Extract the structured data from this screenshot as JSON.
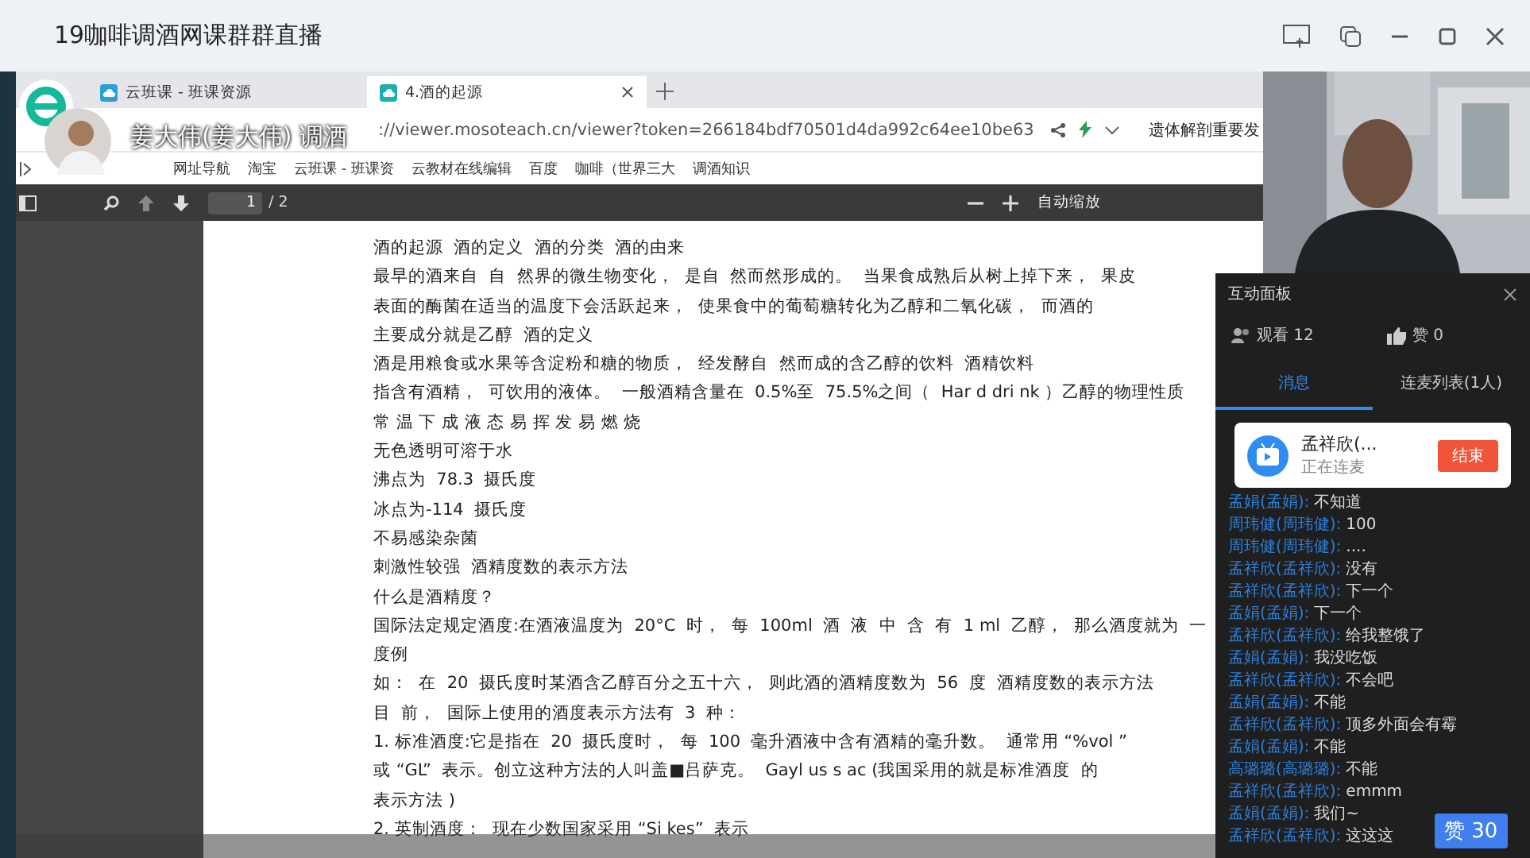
{
  "window": {
    "title": "19咖啡调酒网课群群直播"
  },
  "browser": {
    "tabs": [
      {
        "label": "云班课 - 班课资源",
        "selected": false
      },
      {
        "label": "4.酒的起源",
        "selected": true
      }
    ],
    "url": "://viewer.mosoteach.cn/viewer?token=266184bdf70501d4da992c64ee10be63",
    "presenter": "姜大伟(姜大伟) 调酒",
    "news": "遗体解剖重要发",
    "bookmarks": [
      "网址导航",
      "淘宝",
      "云班课 - 班课资",
      "云教材在线编辑",
      "百度",
      "咖啡（世界三大",
      "调酒知识"
    ]
  },
  "pdf": {
    "page": "1",
    "total": "/ 2",
    "zoom": "自动缩放",
    "lines": [
      "酒的起源  酒的定义  酒的分类  酒的由来",
      "最早的酒来自  自  然界的微生物变化，  是自  然而然形成的。  当果食成熟后从树上掉下来，  果皮",
      "表面的酶菌在适当的温度下会活跃起来，  使果食中的葡萄糖转化为乙醇和二氧化碳，  而酒的",
      "主要成分就是乙醇  酒的定义",
      "酒是用粮食或水果等含淀粉和糖的物质，  经发酵自  然而成的含乙醇的饮料  酒精饮料",
      "指含有酒精，  可饮用的液体。  一般酒精含量在  0.5%至  75.5%之间（  Har d dri nk ）乙醇的物理性质",
      "常 温 下 成 液 态 易 挥 发 易 燃 烧",
      "无色透明可溶于水",
      "沸点为  78.3  摄氏度",
      "冰点为-114  摄氏度",
      "不易感染杂菌",
      "刺激性较强  酒精度数的表示方法",
      "什么是酒精度？",
      "国际法定规定酒度:在酒液温度为  20°C  时，  每  100ml  酒  液  中  含  有  1 ml  乙醇，  那么酒度就为  一",
      "度例",
      "如：  在  20  摄氏度时某酒含乙醇百分之五十六，  则此酒的酒精度数为  56  度  酒精度数的表示方法",
      "目  前，  国际上使用的酒度表示方法有  3  种：",
      "1. 标准酒度:它是指在  20  摄氏度时，  每  100  毫升酒液中含有酒精的毫升数。  通常用 “%vol ”",
      "或 “GL”  表示。创立这种方法的人叫盖■吕萨克。  Gayl us s ac (我国采用的就是标准酒度  的",
      "表示方法 )",
      "2. 英制酒度：  现在少数国家采用 “Si kes”  表示"
    ]
  },
  "panel": {
    "title": "互动面板",
    "viewers": "观看 12",
    "likes": "赞 0",
    "tabs": [
      {
        "label": "消息",
        "selected": true
      },
      {
        "label": "连麦列表(1人)",
        "selected": false
      }
    ],
    "call": {
      "name": "孟祥欣(...",
      "status": "正在连麦",
      "button": "结束"
    },
    "messages": [
      {
        "name": "孟娟(孟娟):",
        "text": "不知道"
      },
      {
        "name": "周玮健(周玮健):",
        "text": "100"
      },
      {
        "name": "周玮健(周玮健):",
        "text": "...."
      },
      {
        "name": "孟祥欣(孟祥欣):",
        "text": "没有"
      },
      {
        "name": "孟祥欣(孟祥欣):",
        "text": "下一个"
      },
      {
        "name": "孟娟(孟娟):",
        "text": "下一个"
      },
      {
        "name": "孟祥欣(孟祥欣):",
        "text": "给我整饿了"
      },
      {
        "name": "孟娟(孟娟):",
        "text": "我没吃饭"
      },
      {
        "name": "孟祥欣(孟祥欣):",
        "text": "不会吧"
      },
      {
        "name": "孟娟(孟娟):",
        "text": "不能"
      },
      {
        "name": "孟祥欣(孟祥欣):",
        "text": "顶多外面会有霉"
      },
      {
        "name": "孟娟(孟娟):",
        "text": "不能"
      },
      {
        "name": "高璐璐(高璐璐):",
        "text": "不能"
      },
      {
        "name": "孟祥欣(孟祥欣):",
        "text": "emmm"
      },
      {
        "name": "孟娟(孟娟):",
        "text": "我们~"
      },
      {
        "name": "孟祥欣(孟祥欣):",
        "text": "这这这"
      }
    ],
    "like_button": "赞 30"
  }
}
